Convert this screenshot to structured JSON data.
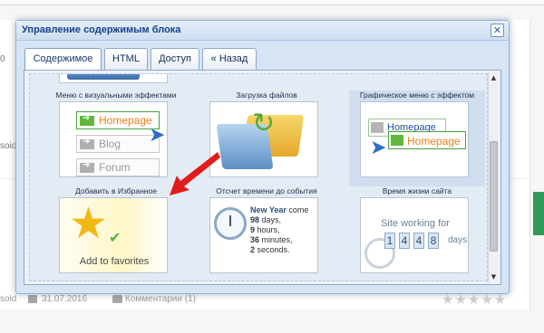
{
  "background": {
    "left_fragment_1": "0",
    "left_fragment_2": "soid",
    "left_fragment_3": "soid",
    "footer": {
      "author_fragment": "soid",
      "date": "31.07.2016",
      "comments": "Комментарии (1)",
      "stars": "★★★★★"
    }
  },
  "dialog": {
    "title": "Управление содержимым блока",
    "close_label": "✕",
    "tabs": [
      {
        "label": "Содержимое",
        "active": true
      },
      {
        "label": "HTML",
        "active": false
      },
      {
        "label": "Доступ",
        "active": false
      },
      {
        "label": "« Назад",
        "active": false
      }
    ],
    "items": [
      {
        "label": "Меню с визуальными эффектами",
        "menu": [
          "Homepage",
          "Blog",
          "Forum"
        ]
      },
      {
        "label": "Загрузка файлов"
      },
      {
        "label": "Графическое меню с эффектом",
        "buttons": [
          "Homepage",
          "Homepage"
        ]
      },
      {
        "label": "Добавить в Избранное",
        "caption": "Add to favorites"
      },
      {
        "label": "Отсчет времени до события",
        "heading": "New Year",
        "heading_suffix": "come",
        "lines": [
          {
            "num": "98",
            "unit": "days,"
          },
          {
            "num": "9",
            "unit": "hours,"
          },
          {
            "num": "36",
            "unit": "minutes,"
          },
          {
            "num": "2",
            "unit": "seconds."
          }
        ]
      },
      {
        "label": "Время жизни сайта",
        "caption": "Site working for",
        "digits": [
          "1",
          "4",
          "4",
          "8"
        ],
        "unit": "days"
      }
    ],
    "scroll": {
      "up": "▲",
      "down": "▼"
    }
  },
  "colors": {
    "accent_orange": "#f07f18",
    "menu_green": "#62b63e",
    "title_blue": "#15428b",
    "dialog_bg": "#d6e4f4",
    "red_arrow": "#e21b1b",
    "cursor_blue": "#2f6fc8"
  },
  "icons": {
    "close": "close-icon",
    "cursor": "cursor-arrow-icon",
    "red_arrow": "red-pointer-arrow-icon",
    "star": "star-icon",
    "clock": "clock-icon",
    "folder": "folder-icon",
    "calendar": "calendar-icon",
    "comment": "comment-icon"
  }
}
